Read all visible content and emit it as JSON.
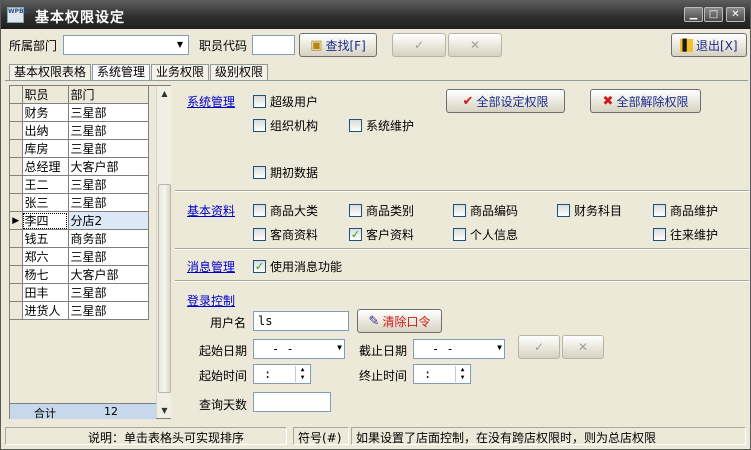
{
  "window": {
    "title": "基本权限设定",
    "app_icon_text": "WPBZ"
  },
  "toolbar": {
    "dept_label": "所属部门",
    "dept_value": "",
    "code_label": "职员代码",
    "code_value": "",
    "find_label": "查找[F]",
    "exit_label": "退出[X]"
  },
  "tabs": [
    "基本权限表格",
    "系统管理",
    "业务权限",
    "级别权限"
  ],
  "active_tab": "系统管理",
  "grid": {
    "columns": [
      "职员",
      "部门"
    ],
    "rows": [
      [
        "财务",
        "三星部"
      ],
      [
        "出纳",
        "三星部"
      ],
      [
        "库房",
        "三星部"
      ],
      [
        "总经理",
        "大客户部"
      ],
      [
        "王二",
        "三星部"
      ],
      [
        "张三",
        "三星部"
      ],
      [
        "李四",
        "分店2"
      ],
      [
        "钱五",
        "商务部"
      ],
      [
        "郑六",
        "三星部"
      ],
      [
        "杨七",
        "大客户部"
      ],
      [
        "田丰",
        "三星部"
      ],
      [
        "进货人",
        "三星部"
      ]
    ],
    "selected_index": 6,
    "total_label": "合计",
    "total_count": "12"
  },
  "system": {
    "title": "系统管理",
    "set_all_label": "全部设定权限",
    "clear_all_label": "全部解除权限",
    "items": [
      {
        "label": "超级用户",
        "checked": false
      },
      {
        "label": "组织机构",
        "checked": false
      },
      {
        "label": "系统维护",
        "checked": false
      },
      {
        "label": "期初数据",
        "checked": false
      }
    ]
  },
  "basic": {
    "title": "基本资料",
    "items": [
      {
        "label": "商品大类",
        "checked": false
      },
      {
        "label": "商品类别",
        "checked": false
      },
      {
        "label": "商品编码",
        "checked": false
      },
      {
        "label": "财务科目",
        "checked": false
      },
      {
        "label": "商品维护",
        "checked": false
      },
      {
        "label": "客商资料",
        "checked": false
      },
      {
        "label": "客户资料",
        "checked": true
      },
      {
        "label": "个人信息",
        "checked": false
      },
      {
        "label": "往来维护",
        "checked": false
      }
    ]
  },
  "message": {
    "title": "消息管理",
    "item": {
      "label": "使用消息功能",
      "checked": true
    }
  },
  "login": {
    "title": "登录控制",
    "username_label": "用户名",
    "username_value": "ls",
    "clear_pwd_label": "清除口令",
    "start_date_label": "起始日期",
    "start_date_value": "-  -",
    "end_date_label": "截止日期",
    "end_date_value": "-  -",
    "start_time_label": "起始时间",
    "start_time_value": ":",
    "end_time_label": "终止时间",
    "end_time_value": ":",
    "query_days_label": "查询天数",
    "query_days_value": ""
  },
  "status": {
    "hint": "说明：单击表格头可实现排序",
    "symbol": "符号(#)",
    "note": "如果设置了店面控制，在没有跨店权限时，则为总店权限"
  }
}
